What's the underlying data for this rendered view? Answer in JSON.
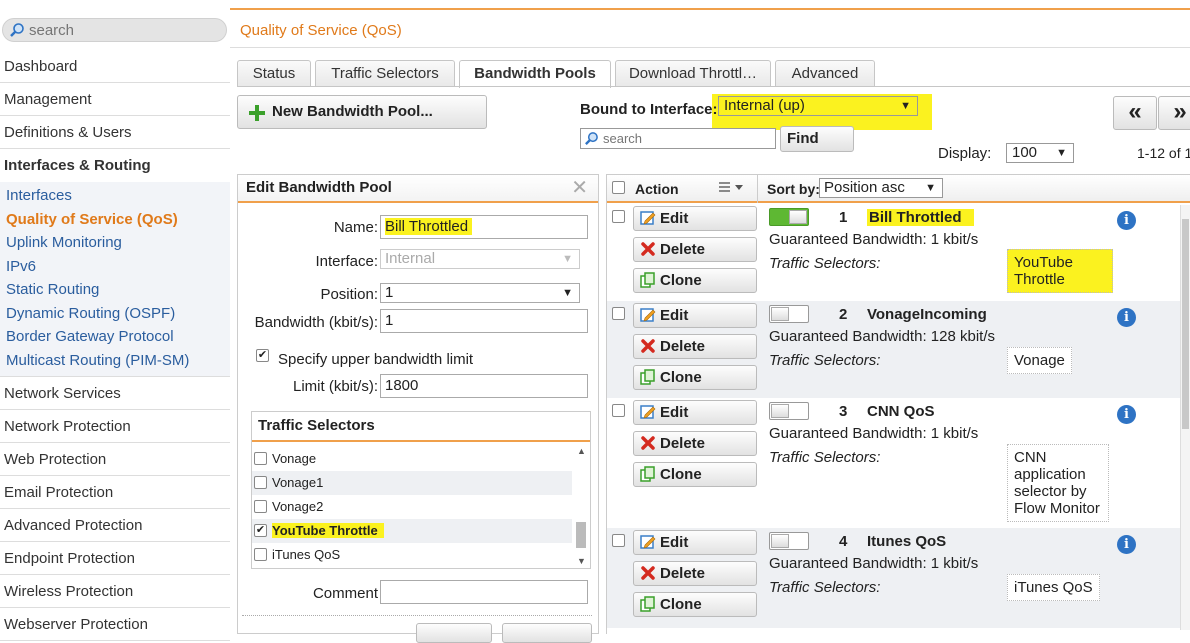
{
  "sidebar": {
    "search_placeholder": "search",
    "top_items": [
      "Dashboard",
      "Management",
      "Definitions & Users"
    ],
    "section": "Interfaces & Routing",
    "sub_items": [
      "Interfaces",
      "Quality of Service (QoS)",
      "Uplink Monitoring",
      "IPv6",
      "Static Routing",
      "Dynamic Routing (OSPF)",
      "Border Gateway Protocol",
      "Multicast Routing (PIM-SM)"
    ],
    "active_sub": "Quality of Service (QoS)",
    "bottom_items": [
      "Network Services",
      "Network Protection",
      "Web Protection",
      "Email Protection",
      "Advanced Protection",
      "Endpoint Protection",
      "Wireless Protection",
      "Webserver Protection"
    ]
  },
  "page_title": "Quality of Service (QoS)",
  "tabs": [
    "Status",
    "Traffic Selectors",
    "Bandwidth Pools",
    "Download Throttl…",
    "Advanced"
  ],
  "active_tab": "Bandwidth Pools",
  "toolbar": {
    "new_pool_label": "New Bandwidth Pool...",
    "bound_label": "Bound to Interface:",
    "bound_value": "Internal (up)",
    "search_placeholder": "search",
    "find_label": "Find",
    "display_label": "Display:",
    "display_value": "100",
    "range_label": "1-12 of 1",
    "pager_first": "«",
    "pager_prev": "»"
  },
  "edit": {
    "title": "Edit Bandwidth Pool",
    "close": "✕",
    "name_label": "Name:",
    "name_value": "Bill Throttled",
    "interface_label": "Interface:",
    "interface_value": "Internal",
    "position_label": "Position:",
    "position_value": "1",
    "bandwidth_label": "Bandwidth (kbit/s):",
    "bandwidth_value": "1",
    "upper_limit_label": "Specify upper bandwidth limit",
    "limit_label": "Limit (kbit/s):",
    "limit_value": "1800",
    "ts_title": "Traffic Selectors",
    "ts_items": [
      {
        "label": "Vonage",
        "checked": false
      },
      {
        "label": "Vonage1",
        "checked": false
      },
      {
        "label": "Vonage2",
        "checked": false
      },
      {
        "label": "YouTube Throttle",
        "checked": true
      },
      {
        "label": "iTunes QoS",
        "checked": false
      }
    ],
    "comment_label": "Comment"
  },
  "list": {
    "action_label": "Action",
    "sort_label": "Sort by:",
    "sort_value": "Position asc",
    "edit_label": "Edit",
    "delete_label": "Delete",
    "clone_label": "Clone",
    "gb_prefix": "Guaranteed Bandwidth:",
    "ts_label": "Traffic Selectors:",
    "pools": [
      {
        "num": "1",
        "name": "Bill Throttled",
        "gb": "Guaranteed Bandwidth: 1 kbit/s",
        "ts": "YouTube Throttle",
        "enabled": true
      },
      {
        "num": "2",
        "name": "VonageIncoming",
        "gb": "Guaranteed Bandwidth: 128 kbit/s",
        "ts": "Vonage",
        "enabled": false
      },
      {
        "num": "3",
        "name": "CNN QoS",
        "gb": "Guaranteed Bandwidth: 1 kbit/s",
        "ts": "CNN application selector by Flow Monitor",
        "enabled": false
      },
      {
        "num": "4",
        "name": "Itunes QoS",
        "gb": "Guaranteed Bandwidth: 1 kbit/s",
        "ts": "iTunes QoS",
        "enabled": false
      }
    ]
  },
  "colors": {
    "accent": "#e07a1a",
    "highlight": "#fbf21f",
    "link": "#2a5d9e",
    "toggle_on": "#5eb833"
  }
}
